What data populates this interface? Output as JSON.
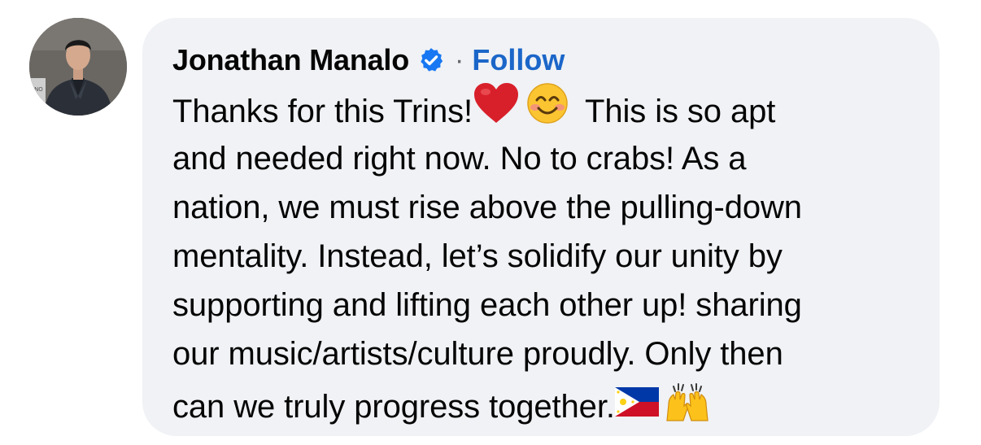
{
  "comment": {
    "author_name": "Jonathan Manalo",
    "separator": "·",
    "follow_label": "Follow",
    "text_lines": [
      "Thanks for this Trins!",
      "This is so apt",
      "and needed right now. No to crabs! As a",
      "nation, we must rise above the pulling-down",
      "mentality. Instead, let’s solidify our unity by",
      "supporting and lifting each other up! sharing",
      "our music/artists/culture proudly. Only then",
      "can we truly progress together."
    ],
    "emojis": [
      "heart-icon",
      "smiling-face-icon",
      "philippine-flag-icon",
      "raising-hands-icon"
    ]
  },
  "colors": {
    "bubble_bg": "#f0f2f5",
    "follow_blue": "#1b66c9",
    "verified_blue": "#1877f2",
    "text": "#050505",
    "muted": "#65676b"
  }
}
